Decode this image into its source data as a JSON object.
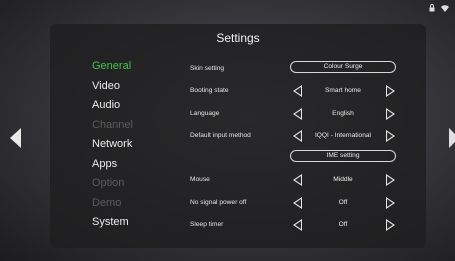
{
  "status": {
    "icons": [
      "lock-icon",
      "wifi-icon"
    ]
  },
  "title": "Settings",
  "menu": [
    {
      "label": "General",
      "state": "active"
    },
    {
      "label": "Video",
      "state": "normal"
    },
    {
      "label": "Audio",
      "state": "normal"
    },
    {
      "label": "Channel",
      "state": "disabled"
    },
    {
      "label": "Network",
      "state": "normal"
    },
    {
      "label": "Apps",
      "state": "normal"
    },
    {
      "label": "Option",
      "state": "disabled"
    },
    {
      "label": "Demo",
      "state": "disabled"
    },
    {
      "label": "System",
      "state": "normal"
    }
  ],
  "settings": {
    "skin": {
      "label": "Skin setting",
      "value": "Colour Surge"
    },
    "booting": {
      "label": "Booting state",
      "value": "Smart home"
    },
    "language": {
      "label": "Language",
      "value": "English"
    },
    "input_method": {
      "label": "Default input method",
      "value": "IQQI - International"
    },
    "ime": {
      "button": "IME setting"
    },
    "mouse": {
      "label": "Mouse",
      "value": "Middle"
    },
    "power_off": {
      "label": "No signal power off",
      "value": "Off"
    },
    "sleep": {
      "label": "Sleep timer",
      "value": "Off"
    }
  },
  "colors": {
    "accent": "#45c24a",
    "disabled": "#5c5c5c"
  }
}
